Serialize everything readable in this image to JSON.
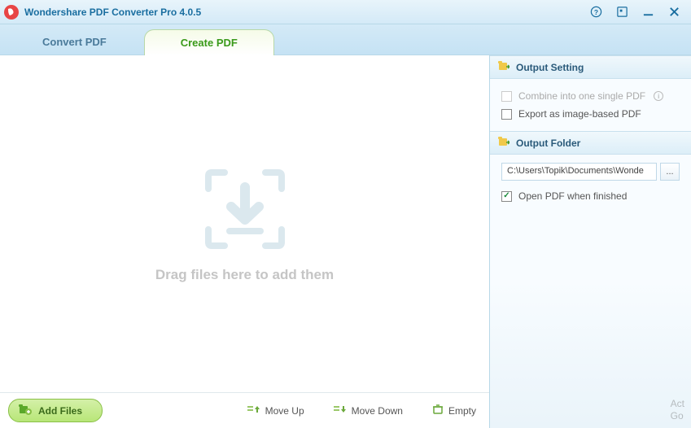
{
  "titlebar": {
    "title": "Wondershare PDF Converter Pro 4.0.5"
  },
  "tabs": {
    "convert": "Convert PDF",
    "create": "Create PDF"
  },
  "dropzone": {
    "text": "Drag files here to add them"
  },
  "toolbar": {
    "add_files": "Add Files",
    "move_up": "Move Up",
    "move_down": "Move Down",
    "empty": "Empty"
  },
  "sidebar": {
    "output_setting": {
      "header": "Output Setting",
      "combine": "Combine into one single PDF",
      "export_image": "Export as image-based PDF"
    },
    "output_folder": {
      "header": "Output Folder",
      "path": "C:\\Users\\Topik\\Documents\\Wonde",
      "browse": "...",
      "open_when_finished": "Open PDF when finished"
    }
  },
  "watermark": {
    "line1": "Act",
    "line2": "Go"
  }
}
